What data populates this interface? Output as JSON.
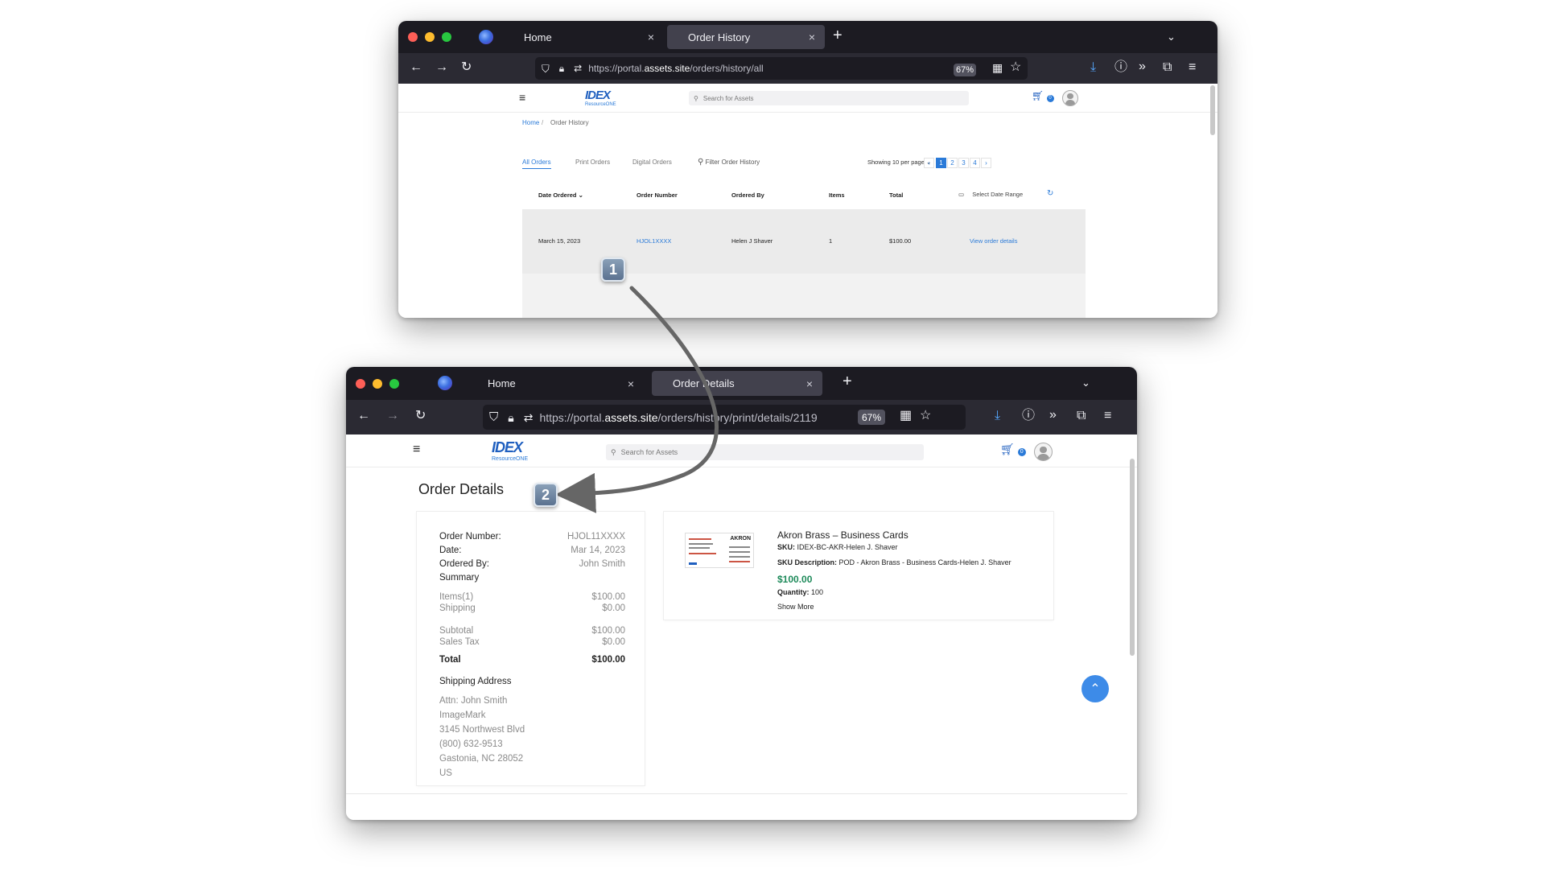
{
  "win1": {
    "tabs": [
      {
        "label": "Home",
        "close": "×"
      },
      {
        "label": "Order History",
        "close": "×"
      }
    ],
    "new_tab": "+",
    "url": {
      "prefix": "https://portal.",
      "domain": "assets.site",
      "path": "/orders/history/all"
    },
    "zoom": "67%",
    "site": {
      "logo": "IDEX",
      "logo_sub": "ResourceONE",
      "search_placeholder": "Search for Assets",
      "cart_count": "0"
    },
    "breadcrumb": {
      "home": "Home",
      "sep": "/",
      "current": "Order History"
    },
    "filter_tabs": [
      "All Orders",
      "Print Orders",
      "Digital Orders"
    ],
    "filter_search": "Filter Order History",
    "per_page": "Showing 10 per page",
    "pages": [
      "1",
      "2",
      "3",
      "4"
    ],
    "table": {
      "headers": [
        "Date Ordered",
        "Order Number",
        "Ordered By",
        "Items",
        "Total"
      ],
      "date_range": "Select Date Range",
      "rows": [
        {
          "date": "March 15, 2023",
          "number": "HJOL1XXXX",
          "by": "Helen J Shaver",
          "items": "1",
          "total": "$100.00",
          "link": "View order details"
        }
      ]
    }
  },
  "win2": {
    "tabs": [
      {
        "label": "Home",
        "close": "×"
      },
      {
        "label": "Order Details",
        "close": "×"
      }
    ],
    "new_tab": "+",
    "url": {
      "prefix": "https://portal.",
      "domain": "assets.site",
      "path": "/orders/history/print/details/2119"
    },
    "zoom": "67%",
    "site": {
      "logo": "IDEX",
      "logo_sub": "ResourceONE",
      "search_placeholder": "Search for Assets",
      "cart_count": "0"
    },
    "page_title": "Order Details",
    "summary": {
      "order_number_label": "Order Number:",
      "order_number": "HJOL11XXXX",
      "date_label": "Date:",
      "date": "Mar 14, 2023",
      "ordered_by_label": "Ordered By:",
      "ordered_by": "John Smith",
      "summary_label": "Summary",
      "items_label": "Items(1)",
      "items": "$100.00",
      "shipping_label": "Shipping",
      "shipping": "$0.00",
      "subtotal_label": "Subtotal",
      "subtotal": "$100.00",
      "tax_label": "Sales Tax",
      "tax": "$0.00",
      "total_label": "Total",
      "total": "$100.00",
      "ship_title": "Shipping Address",
      "address": [
        "Attn: John Smith",
        "ImageMark",
        "3145 Northwest Blvd",
        "(800) 632-9513",
        "Gastonia, NC 28052",
        "US"
      ]
    },
    "product": {
      "name": "Akron Brass – Business Cards",
      "sku_label": "SKU:",
      "sku": "IDEX-BC-AKR-Helen J. Shaver",
      "desc_label": "SKU Description:",
      "desc": "POD - Akron Brass - Business Cards-Helen J. Shaver",
      "price": "$100.00",
      "qty_label": "Quantity:",
      "qty": "100",
      "show_more": "Show More",
      "thumb_brand": "AKRON"
    }
  },
  "steps": [
    "1",
    "2"
  ],
  "colors": {
    "accent": "#2a7ad8",
    "price": "#1e8a5a",
    "tab_bar": "#1c1b22",
    "nav_bar": "#2b2a33"
  }
}
